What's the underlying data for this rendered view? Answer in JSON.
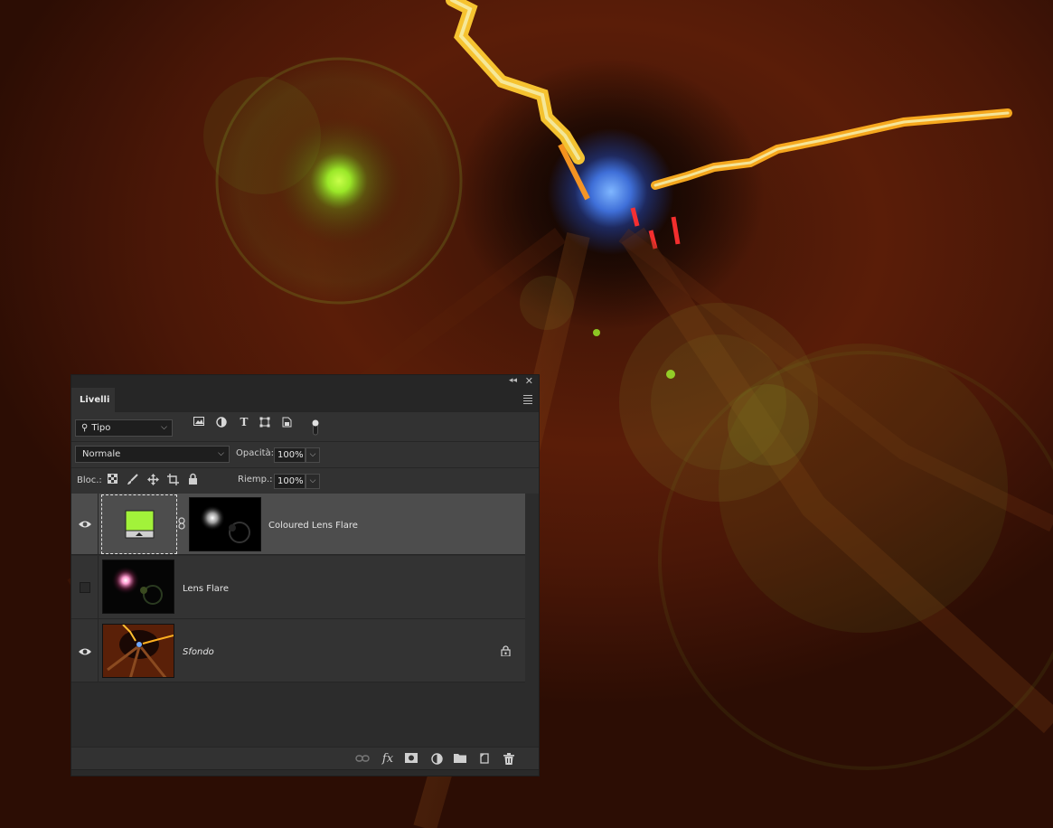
{
  "panel": {
    "tab_label": "Livelli",
    "filter": {
      "kind_label": "Tipo"
    },
    "blend_mode": "Normale",
    "opacity_label": "Opacità:",
    "opacity_value": "100%",
    "lock_label": "Bloc.:",
    "fill_label": "Riemp.:",
    "fill_value": "100%",
    "layers": [
      {
        "name": "Coloured Lens Flare",
        "visible": true,
        "selected": true,
        "fill_color": "#a2f23a"
      },
      {
        "name": "Lens Flare",
        "visible": false,
        "selected": false
      },
      {
        "name": "Sfondo",
        "visible": true,
        "selected": false,
        "locked": true
      }
    ]
  },
  "colors": {
    "panel_bg": "#323232",
    "selected_row": "#4d4d4d",
    "flare_green": "#9ef22a",
    "tunnel_blue": "#6fa8ff",
    "tunnel_orange": "#ffb020"
  }
}
